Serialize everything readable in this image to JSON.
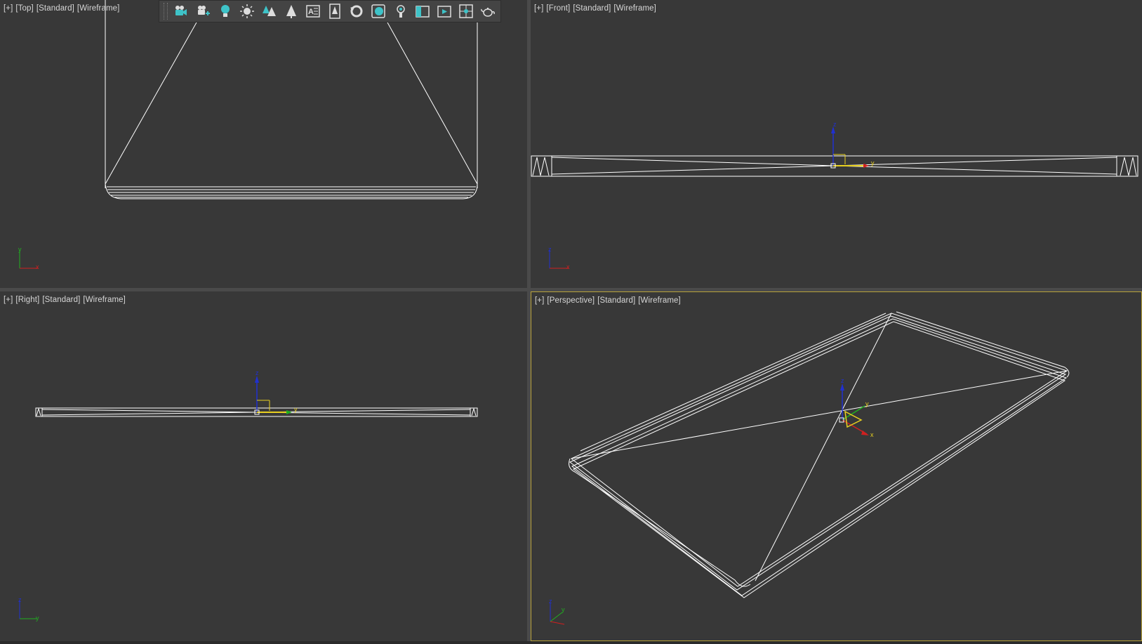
{
  "viewports": {
    "top": {
      "plus": "[+]",
      "view": "[Top]",
      "shading": "[Standard]",
      "mode": "[Wireframe]"
    },
    "front": {
      "plus": "[+]",
      "view": "[Front]",
      "shading": "[Standard]",
      "mode": "[Wireframe]"
    },
    "right": {
      "plus": "[+]",
      "view": "[Right]",
      "shading": "[Standard]",
      "mode": "[Wireframe]"
    },
    "perspective": {
      "plus": "[+]",
      "view": "[Perspective]",
      "shading": "[Standard]",
      "mode": "[Wireframe]"
    }
  },
  "axes": {
    "top": [
      "y",
      "x"
    ],
    "front": [
      "z",
      "x"
    ],
    "right": [
      "z",
      "y"
    ],
    "perspective": [
      "z",
      "y"
    ],
    "gizmo": {
      "z": "z",
      "y": "y",
      "x": "x"
    }
  },
  "toolbar": {
    "icons": [
      "camera-icon",
      "camera-target-icon",
      "light-bulb-icon",
      "sun-light-icon",
      "trees-icon",
      "tree-icon",
      "text-panel-icon",
      "tree-panel-icon",
      "rotate-icon",
      "render-frame-icon",
      "point-light-icon",
      "viewport-panel-icon",
      "render-window-icon",
      "safe-frame-icon",
      "teapot-icon"
    ],
    "accent": "#3ec3c8"
  },
  "colors": {
    "viewport_bg": "#383838",
    "wire": "#ffffff",
    "active_border": "#b8a23a",
    "axis_x": "#d02020",
    "axis_y": "#20b020",
    "axis_z": "#2030d0",
    "gizmo_yellow": "#e8d020"
  }
}
